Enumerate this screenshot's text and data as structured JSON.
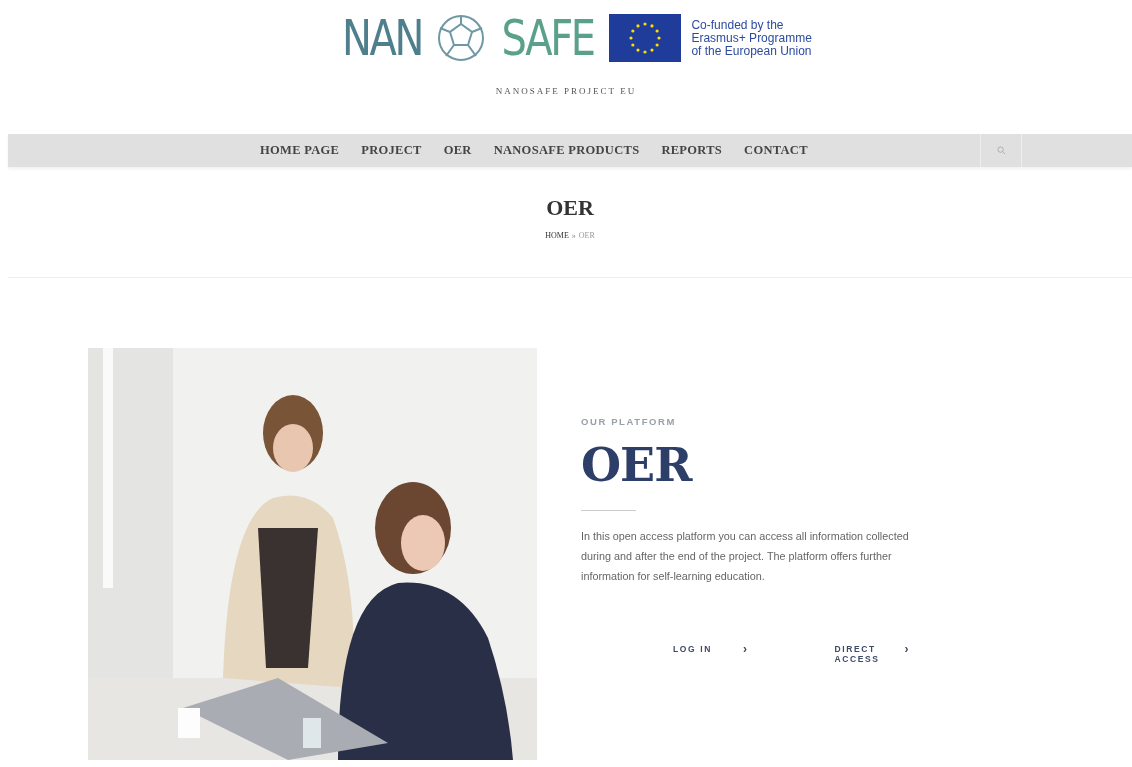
{
  "logo": {
    "left": "NAN",
    "right": "SAFE",
    "funding": [
      "Co-funded by the",
      "Erasmus+ Programme",
      "of the European Union"
    ]
  },
  "tagline": "NANOSAFE PROJECT EU",
  "nav": [
    {
      "label": "HOME PAGE"
    },
    {
      "label": "PROJECT"
    },
    {
      "label": "OER"
    },
    {
      "label": "NANOSAFE PRODUCTS"
    },
    {
      "label": "REPORTS"
    },
    {
      "label": "CONTACT"
    }
  ],
  "page_title": "OER",
  "breadcrumb": {
    "home": "HOME",
    "separator": "»",
    "current": "OER"
  },
  "section": {
    "eyebrow": "OUR PLATFORM",
    "title": "OER",
    "text": "In this open access platform you can access all information collected during and after the end of the project. The platform offers further information for self-learning education.",
    "links": [
      {
        "label": "LOG IN",
        "arrow": "›"
      },
      {
        "label": "DIRECT ACCESS",
        "arrow": "›"
      }
    ]
  }
}
